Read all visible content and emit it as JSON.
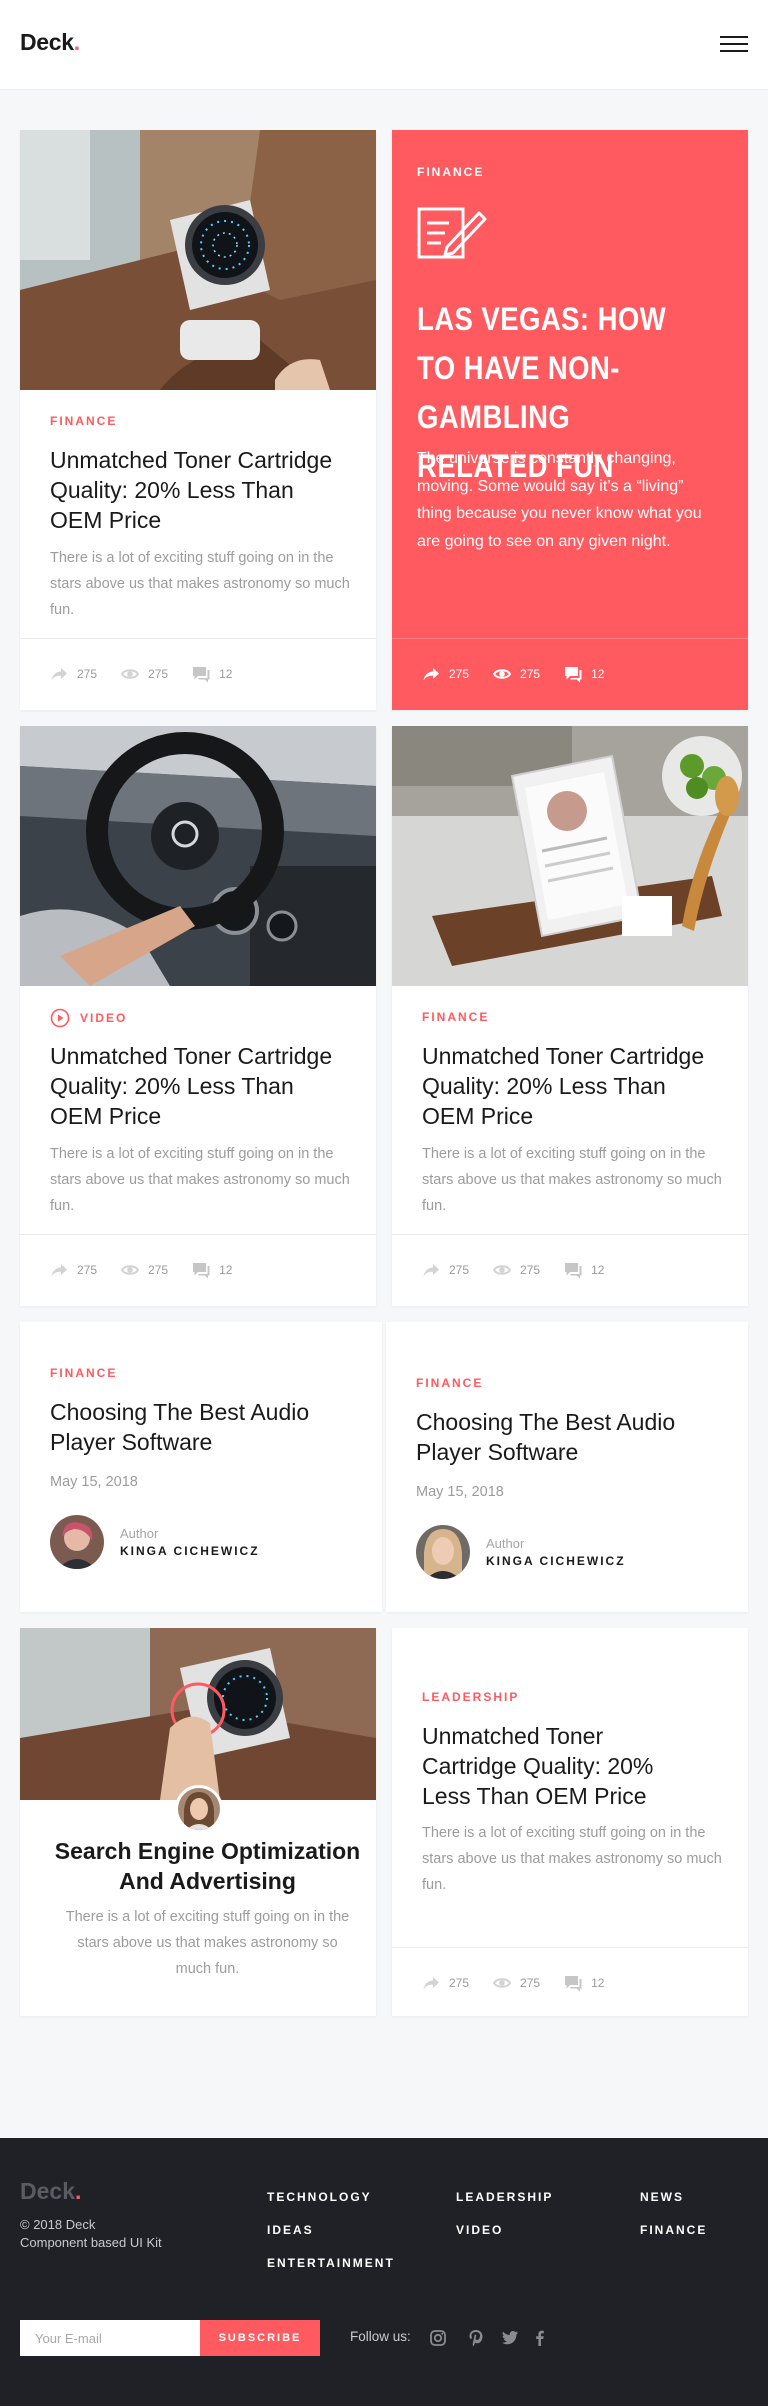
{
  "header": {
    "logo_text": "Deck",
    "logo_dot": ".",
    "menu_icon": "hamburger-menu-icon"
  },
  "colors": {
    "accent": "#ff5a5f",
    "background": "#f6f7f9",
    "footer": "#202126"
  },
  "cards": {
    "card1": {
      "category": "FINANCE",
      "title": "Unmatched Toner Cartridge Quality: 20% Less Than OEM Price",
      "excerpt": "There is a lot of exciting stuff going on in the stars above us that makes astronomy so much fun.",
      "shares": "275",
      "views": "275",
      "comments": "12"
    },
    "card2": {
      "category": "FINANCE",
      "icon": "edit-note-icon",
      "title": "LAS VEGAS: HOW TO HAVE NON-GAMBLING RELATED FUN",
      "text": "The universe is constantly changing, moving. Some would say it’s a “living” thing because you never know what you are going to see on any given night.",
      "shares": "275",
      "views": "275",
      "comments": "12"
    },
    "card3": {
      "category": "VIDEO",
      "title": "Unmatched Toner Cartridge Quality: 20% Less Than OEM Price",
      "excerpt": "There is a lot of exciting stuff going on in the stars above us that makes astronomy so much fun.",
      "shares": "275",
      "views": "275",
      "comments": "12"
    },
    "card4": {
      "category": "FINANCE",
      "title": "Unmatched Toner Cartridge Quality: 20% Less Than OEM Price",
      "excerpt": "There is a lot of exciting stuff going on in the stars above us that makes astronomy so much fun.",
      "shares": "275",
      "views": "275",
      "comments": "12"
    },
    "card5": {
      "category": "FINANCE",
      "title": "Choosing The Best Audio Player Software",
      "date": "May 15, 2018",
      "author_label": "Author",
      "author_name": "KINGA CICHEWICZ"
    },
    "card6": {
      "category": "FINANCE",
      "title": "Choosing The Best Audio Player Software",
      "date": "May 15, 2018",
      "author_label": "Author",
      "author_name": "KINGA CICHEWICZ"
    },
    "card7": {
      "title": "Search Engine Optimization And Advertising",
      "excerpt": "There is a lot of exciting stuff going on in the stars above us that makes astronomy so much fun."
    },
    "card8": {
      "category": "LEADERSHIP",
      "title": "Unmatched Toner Cartridge Quality: 20% Less Than OEM Price",
      "excerpt": "There is a lot of exciting stuff going on in the stars above us that makes astronomy so much fun.",
      "shares": "275",
      "views": "275",
      "comments": "12"
    }
  },
  "footer": {
    "logo_text": "Deck",
    "logo_dot": ".",
    "copyright": "© 2018 Deck",
    "tagline": "Component based UI Kit",
    "links": {
      "technology": "TECHNOLOGY",
      "leadership": "LEADERSHIP",
      "news": "NEWS",
      "ideas": "IDEAS",
      "video": "VIDEO",
      "finance": "FINANCE",
      "entertainment": "ENTERTAINMENT"
    },
    "email_placeholder": "Your E-mail",
    "subscribe_label": "SUBSCRIBE",
    "follow_label": "Follow us:",
    "social_icons": [
      "instagram-icon",
      "pinterest-icon",
      "twitter-icon",
      "facebook-icon"
    ]
  }
}
